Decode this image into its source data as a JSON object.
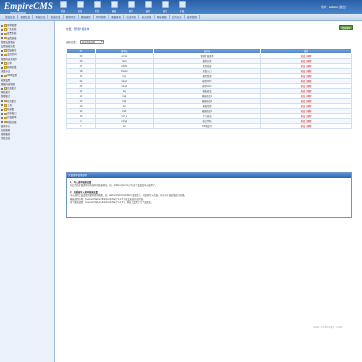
{
  "logo": {
    "text": "EmpireCMS",
    "sub": "帝国网站管理系统"
  },
  "toolbar": [
    {
      "label": "系统"
    },
    {
      "label": "信息"
    },
    {
      "label": "栏目"
    },
    {
      "label": "模板"
    },
    {
      "label": "用户"
    },
    {
      "label": "插件"
    },
    {
      "label": "其它"
    },
    {
      "label": "扩展"
    }
  ],
  "user": {
    "prefix": "用户：",
    "name": "admin",
    "suffix": " [退出]"
  },
  "nav": [
    {
      "label": "增加信息"
    },
    {
      "label": "管理信息"
    },
    {
      "label": "审核信息"
    },
    {
      "label": "签发信息"
    },
    {
      "label": "管理评论"
    },
    {
      "label": "数据更新"
    },
    {
      "label": "附件管理"
    },
    {
      "label": "数据备份"
    },
    {
      "label": "后台首页"
    },
    {
      "label": "站点首页"
    },
    {
      "label": "网站地图"
    },
    {
      "label": "后台日志"
    },
    {
      "label": "插件管理"
    }
  ],
  "tree": [
    {
      "label": "其他管理",
      "depth": 0,
      "folder": true
    },
    {
      "label": "广告系统",
      "depth": 1,
      "folder": true
    },
    {
      "label": "投票系统",
      "depth": 1,
      "folder": true
    },
    {
      "label": "友情链接",
      "depth": 1,
      "folder": true
    },
    {
      "label": "管理友情链接",
      "depth": 2
    },
    {
      "label": "友情链接分类",
      "depth": 2
    },
    {
      "label": "错误报告",
      "depth": 1,
      "folder": true
    },
    {
      "label": "会员空间",
      "depth": 1,
      "folder": true
    },
    {
      "label": "管理内容关键字",
      "depth": 2
    },
    {
      "label": "订单",
      "depth": 1,
      "folder": true
    },
    {
      "label": "新闻采集",
      "depth": 1,
      "folder": true
    },
    {
      "label": "采集节点",
      "depth": 2
    },
    {
      "label": "WAP设置",
      "depth": 1,
      "folder": true
    },
    {
      "label": "权限设置",
      "depth": 2,
      "selected": true
    },
    {
      "label": "模版内容管理",
      "depth": 2
    },
    {
      "label": "信息统计",
      "depth": 1,
      "folder": true
    },
    {
      "label": "网站统计",
      "depth": 2
    },
    {
      "label": "管理统计",
      "depth": 2
    },
    {
      "label": "综合统计",
      "depth": 1,
      "folder": true
    },
    {
      "label": "工具",
      "depth": 1,
      "folder": true
    },
    {
      "label": "防采集",
      "depth": 1,
      "folder": true
    },
    {
      "label": "开放接口",
      "depth": 1,
      "folder": true
    },
    {
      "label": "扩展菜单",
      "depth": 1,
      "folder": true
    },
    {
      "label": "附加功能",
      "depth": 1,
      "folder": true
    },
    {
      "label": "服务中心",
      "depth": 2
    },
    {
      "label": "在线更新",
      "depth": 2
    },
    {
      "label": "管理备份",
      "depth": 2
    },
    {
      "label": "系统信息",
      "depth": 2
    }
  ],
  "breadcrumb": {
    "prefix": "位置：",
    "link": "管理扩展菜单"
  },
  "add_button": "增加菜单",
  "filter": {
    "label": "选择分类：",
    "value": "显示所有分类"
  },
  "table": {
    "headers": [
      "ID",
      "菜单名",
      "显示名",
      "操作"
    ],
    "rows": [
      [
        "23",
        "ecms",
        "管理扩展菜单",
        "修改 | 删除"
      ],
      [
        "16",
        "duio",
        "模型分类",
        "修改 | 删除"
      ],
      [
        "17",
        "bbsfk",
        "类别链接",
        "修改 | 删除"
      ],
      [
        "18",
        "kdsub",
        "采集入口",
        "修改 | 删除"
      ],
      [
        "15",
        "kyo",
        "模型管理",
        "修改 | 删除"
      ],
      [
        "24",
        "kaq1",
        "模型QQ1",
        "修改 | 删除"
      ],
      [
        "25",
        "kaq2",
        "模型QQ2",
        "修改 | 删除"
      ],
      [
        "11",
        "ksj",
        "模板修改",
        "修改 | 删除"
      ],
      [
        "12",
        "ksjj",
        "模板修改1",
        "修改 | 删除"
      ],
      [
        "13",
        "ksjt",
        "模板修改2",
        "修改 | 删除"
      ],
      [
        "10",
        "ksi",
        "模板管理",
        "修改 | 删除"
      ],
      [
        "14",
        "kwt",
        "模板修改3",
        "修改 | 删除"
      ],
      [
        "19",
        "kxf_s",
        "专门板块",
        "修改 | 删除"
      ],
      [
        "2",
        "kmgl",
        "统计代码",
        "修改 | 删除"
      ],
      [
        "1",
        "kio",
        "ICP备案号",
        "修改 | 删除"
      ]
    ]
  },
  "pager": "",
  "note": {
    "header": "扩展菜单使用说明",
    "lines": [
      {
        "bold": true,
        "text": "1、写入菜单链接变量"
      },
      {
        "bold": false,
        "text": "在后台的扩展菜单中添加你的链接地址，如：ehttp://[ecms_id] 这个变量就可以使用了。"
      },
      {
        "bold": false,
        "text": ""
      },
      {
        "bold": true,
        "text": "2、在模板写入菜单链接变量"
      },
      {
        "bold": false,
        "text": "可以调用上面设置的菜单调用函数，如：ReturnPublicAddVar('变量名')，可选择写入页面，也可对于返回值进行处理。"
      },
      {
        "bold": false,
        "text": "模板调用示例：$value=ReturnPublicAddVar('1,2,3');就会返回对应的值。"
      },
      {
        "bold": false,
        "text": "多个数组调用：$value=ReturnPublicAddVar('1,2,3')，即如上设置了几个变量名。"
      }
    ]
  },
  "watermark": "www.cnblogs.com"
}
